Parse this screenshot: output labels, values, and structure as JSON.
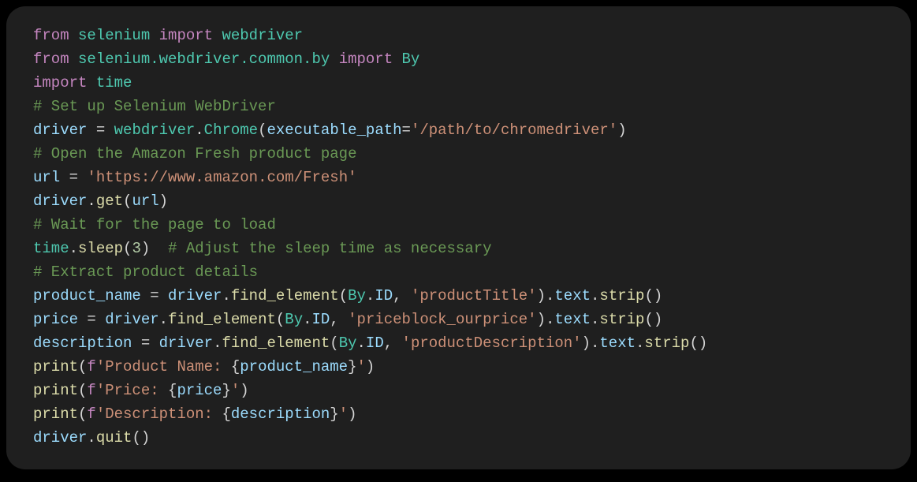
{
  "code": {
    "lines": [
      {
        "tokens": [
          {
            "cls": "tok-kw",
            "t": "from"
          },
          {
            "cls": "tok-plain",
            "t": " "
          },
          {
            "cls": "tok-mod",
            "t": "selenium"
          },
          {
            "cls": "tok-plain",
            "t": " "
          },
          {
            "cls": "tok-kw",
            "t": "import"
          },
          {
            "cls": "tok-plain",
            "t": " "
          },
          {
            "cls": "tok-mod",
            "t": "webdriver"
          }
        ]
      },
      {
        "tokens": [
          {
            "cls": "tok-kw",
            "t": "from"
          },
          {
            "cls": "tok-plain",
            "t": " "
          },
          {
            "cls": "tok-mod",
            "t": "selenium.webdriver.common.by"
          },
          {
            "cls": "tok-plain",
            "t": " "
          },
          {
            "cls": "tok-kw",
            "t": "import"
          },
          {
            "cls": "tok-plain",
            "t": " "
          },
          {
            "cls": "tok-mod",
            "t": "By"
          }
        ]
      },
      {
        "tokens": [
          {
            "cls": "tok-kw",
            "t": "import"
          },
          {
            "cls": "tok-plain",
            "t": " "
          },
          {
            "cls": "tok-mod",
            "t": "time"
          }
        ]
      },
      {
        "tokens": [
          {
            "cls": "tok-cmt",
            "t": "# Set up Selenium WebDriver"
          }
        ]
      },
      {
        "tokens": [
          {
            "cls": "tok-id",
            "t": "driver"
          },
          {
            "cls": "tok-plain",
            "t": " = "
          },
          {
            "cls": "tok-mod",
            "t": "webdriver"
          },
          {
            "cls": "tok-plain",
            "t": "."
          },
          {
            "cls": "tok-cls",
            "t": "Chrome"
          },
          {
            "cls": "tok-plain",
            "t": "("
          },
          {
            "cls": "tok-id",
            "t": "executable_path"
          },
          {
            "cls": "tok-plain",
            "t": "="
          },
          {
            "cls": "tok-str",
            "t": "'/path/to/chromedriver'"
          },
          {
            "cls": "tok-plain",
            "t": ")"
          }
        ]
      },
      {
        "tokens": [
          {
            "cls": "tok-cmt",
            "t": "# Open the Amazon Fresh product page"
          }
        ]
      },
      {
        "tokens": [
          {
            "cls": "tok-id",
            "t": "url"
          },
          {
            "cls": "tok-plain",
            "t": " = "
          },
          {
            "cls": "tok-str",
            "t": "'https://www.amazon.com/Fresh'"
          }
        ]
      },
      {
        "tokens": [
          {
            "cls": "tok-id",
            "t": "driver"
          },
          {
            "cls": "tok-plain",
            "t": "."
          },
          {
            "cls": "tok-fn",
            "t": "get"
          },
          {
            "cls": "tok-plain",
            "t": "("
          },
          {
            "cls": "tok-id",
            "t": "url"
          },
          {
            "cls": "tok-plain",
            "t": ")"
          }
        ]
      },
      {
        "tokens": [
          {
            "cls": "tok-cmt",
            "t": "# Wait for the page to load"
          }
        ]
      },
      {
        "tokens": [
          {
            "cls": "tok-mod",
            "t": "time"
          },
          {
            "cls": "tok-plain",
            "t": "."
          },
          {
            "cls": "tok-fn",
            "t": "sleep"
          },
          {
            "cls": "tok-plain",
            "t": "("
          },
          {
            "cls": "tok-num",
            "t": "3"
          },
          {
            "cls": "tok-plain",
            "t": ")  "
          },
          {
            "cls": "tok-cmt",
            "t": "# Adjust the sleep time as necessary"
          }
        ]
      },
      {
        "tokens": [
          {
            "cls": "tok-cmt",
            "t": "# Extract product details"
          }
        ]
      },
      {
        "tokens": [
          {
            "cls": "tok-id",
            "t": "product_name"
          },
          {
            "cls": "tok-plain",
            "t": " = "
          },
          {
            "cls": "tok-id",
            "t": "driver"
          },
          {
            "cls": "tok-plain",
            "t": "."
          },
          {
            "cls": "tok-fn",
            "t": "find_element"
          },
          {
            "cls": "tok-plain",
            "t": "("
          },
          {
            "cls": "tok-cls",
            "t": "By"
          },
          {
            "cls": "tok-plain",
            "t": "."
          },
          {
            "cls": "tok-const",
            "t": "ID"
          },
          {
            "cls": "tok-plain",
            "t": ", "
          },
          {
            "cls": "tok-str",
            "t": "'productTitle'"
          },
          {
            "cls": "tok-plain",
            "t": ")."
          },
          {
            "cls": "tok-id",
            "t": "text"
          },
          {
            "cls": "tok-plain",
            "t": "."
          },
          {
            "cls": "tok-fn",
            "t": "strip"
          },
          {
            "cls": "tok-plain",
            "t": "()"
          }
        ]
      },
      {
        "tokens": [
          {
            "cls": "tok-id",
            "t": "price"
          },
          {
            "cls": "tok-plain",
            "t": " = "
          },
          {
            "cls": "tok-id",
            "t": "driver"
          },
          {
            "cls": "tok-plain",
            "t": "."
          },
          {
            "cls": "tok-fn",
            "t": "find_element"
          },
          {
            "cls": "tok-plain",
            "t": "("
          },
          {
            "cls": "tok-cls",
            "t": "By"
          },
          {
            "cls": "tok-plain",
            "t": "."
          },
          {
            "cls": "tok-const",
            "t": "ID"
          },
          {
            "cls": "tok-plain",
            "t": ", "
          },
          {
            "cls": "tok-str",
            "t": "'priceblock_ourprice'"
          },
          {
            "cls": "tok-plain",
            "t": ")."
          },
          {
            "cls": "tok-id",
            "t": "text"
          },
          {
            "cls": "tok-plain",
            "t": "."
          },
          {
            "cls": "tok-fn",
            "t": "strip"
          },
          {
            "cls": "tok-plain",
            "t": "()"
          }
        ]
      },
      {
        "tokens": [
          {
            "cls": "tok-id",
            "t": "description"
          },
          {
            "cls": "tok-plain",
            "t": " = "
          },
          {
            "cls": "tok-id",
            "t": "driver"
          },
          {
            "cls": "tok-plain",
            "t": "."
          },
          {
            "cls": "tok-fn",
            "t": "find_element"
          },
          {
            "cls": "tok-plain",
            "t": "("
          },
          {
            "cls": "tok-cls",
            "t": "By"
          },
          {
            "cls": "tok-plain",
            "t": "."
          },
          {
            "cls": "tok-const",
            "t": "ID"
          },
          {
            "cls": "tok-plain",
            "t": ", "
          },
          {
            "cls": "tok-str",
            "t": "'productDescription'"
          },
          {
            "cls": "tok-plain",
            "t": ")."
          },
          {
            "cls": "tok-id",
            "t": "text"
          },
          {
            "cls": "tok-plain",
            "t": "."
          },
          {
            "cls": "tok-fn",
            "t": "strip"
          },
          {
            "cls": "tok-plain",
            "t": "()"
          }
        ]
      },
      {
        "tokens": [
          {
            "cls": "tok-fn",
            "t": "print"
          },
          {
            "cls": "tok-plain",
            "t": "("
          },
          {
            "cls": "tok-kw",
            "t": "f"
          },
          {
            "cls": "tok-str",
            "t": "'Product Name: "
          },
          {
            "cls": "tok-plain",
            "t": "{"
          },
          {
            "cls": "tok-id",
            "t": "product_name"
          },
          {
            "cls": "tok-plain",
            "t": "}"
          },
          {
            "cls": "tok-str",
            "t": "'"
          },
          {
            "cls": "tok-plain",
            "t": ")"
          }
        ]
      },
      {
        "tokens": [
          {
            "cls": "tok-fn",
            "t": "print"
          },
          {
            "cls": "tok-plain",
            "t": "("
          },
          {
            "cls": "tok-kw",
            "t": "f"
          },
          {
            "cls": "tok-str",
            "t": "'Price: "
          },
          {
            "cls": "tok-plain",
            "t": "{"
          },
          {
            "cls": "tok-id",
            "t": "price"
          },
          {
            "cls": "tok-plain",
            "t": "}"
          },
          {
            "cls": "tok-str",
            "t": "'"
          },
          {
            "cls": "tok-plain",
            "t": ")"
          }
        ]
      },
      {
        "tokens": [
          {
            "cls": "tok-fn",
            "t": "print"
          },
          {
            "cls": "tok-plain",
            "t": "("
          },
          {
            "cls": "tok-kw",
            "t": "f"
          },
          {
            "cls": "tok-str",
            "t": "'Description: "
          },
          {
            "cls": "tok-plain",
            "t": "{"
          },
          {
            "cls": "tok-id",
            "t": "description"
          },
          {
            "cls": "tok-plain",
            "t": "}"
          },
          {
            "cls": "tok-str",
            "t": "'"
          },
          {
            "cls": "tok-plain",
            "t": ")"
          }
        ]
      },
      {
        "tokens": [
          {
            "cls": "tok-id",
            "t": "driver"
          },
          {
            "cls": "tok-plain",
            "t": "."
          },
          {
            "cls": "tok-fn",
            "t": "quit"
          },
          {
            "cls": "tok-plain",
            "t": "()"
          }
        ]
      }
    ]
  }
}
